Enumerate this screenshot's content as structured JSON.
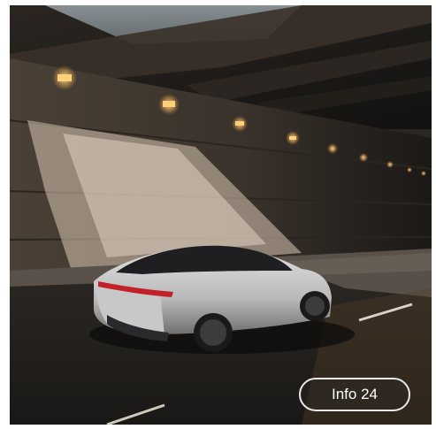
{
  "image": {
    "subject": "car-in-tunnel-photo"
  },
  "info_button": {
    "label": "Info 24"
  },
  "colors": {
    "button_border": "#e9e9e9",
    "button_text": "#ffffff",
    "car_body": "#c9c9c9",
    "light": "#ffcc7a"
  }
}
